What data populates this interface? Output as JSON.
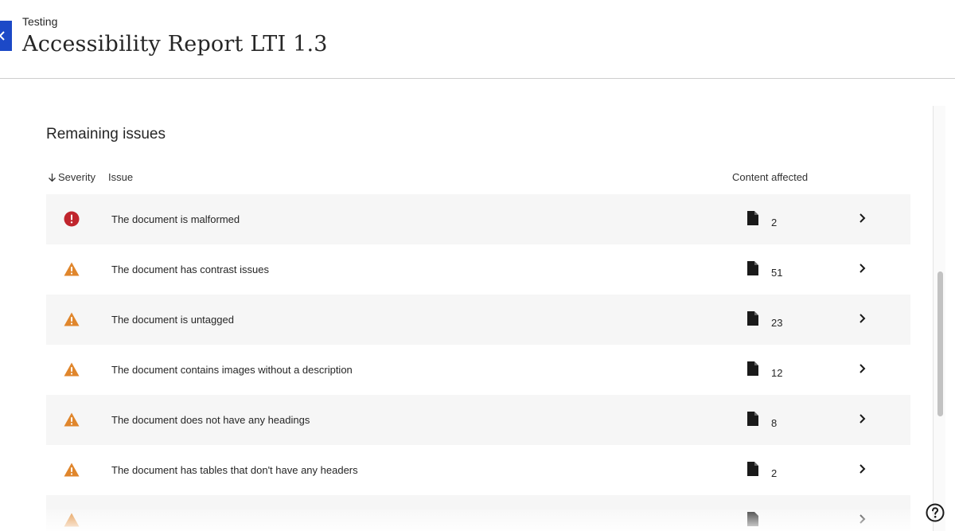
{
  "header": {
    "breadcrumb": "Testing",
    "title": "Accessibility Report LTI 1.3",
    "back_icon": "chevron-left-icon"
  },
  "section": {
    "title": "Remaining issues"
  },
  "columns": {
    "severity": "Severity",
    "severity_sort_icon": "arrow-down-icon",
    "issue": "Issue",
    "content_affected": "Content affected"
  },
  "issues": [
    {
      "severity": "error",
      "icon": "error-circle-icon",
      "text": "The document is malformed",
      "count": "2"
    },
    {
      "severity": "warning",
      "icon": "warning-triangle-icon",
      "text": "The document has contrast issues",
      "count": "51"
    },
    {
      "severity": "warning",
      "icon": "warning-triangle-icon",
      "text": "The document is untagged",
      "count": "23"
    },
    {
      "severity": "warning",
      "icon": "warning-triangle-icon",
      "text": "The document contains images without a description",
      "count": "12"
    },
    {
      "severity": "warning",
      "icon": "warning-triangle-icon",
      "text": "The document does not have any headings",
      "count": "8"
    },
    {
      "severity": "warning",
      "icon": "warning-triangle-icon",
      "text": "The document has tables that don't have any headers",
      "count": "2"
    }
  ],
  "colors": {
    "accent": "#1c49c7",
    "error": "#c0252d",
    "warning": "#e0862c",
    "row_shade": "#f6f6f6"
  },
  "help_icon": "help-circle-icon"
}
